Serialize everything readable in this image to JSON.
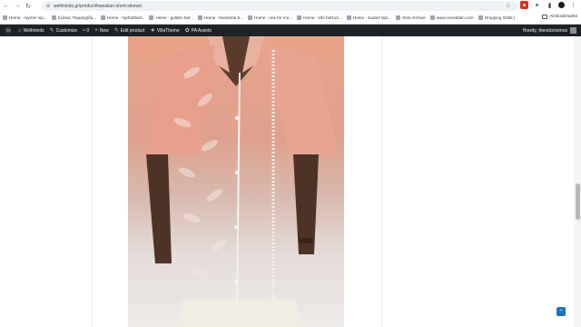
{
  "browser": {
    "url": "wellminds.gr/product/hawaiian-short-sleeve/",
    "bookmarks": [
      "Home - reymer wp...",
      "Σύλλας Παρασχίδη...",
      "Home - topfootball...",
      "Home - golden bet...",
      "Home - benzema b...",
      "Home - one for mo...",
      "Home - info bet1x2...",
      "Home - suarez tips...",
      "Sms Archive",
      "www.cenoddan.com",
      "Dropping Odds |"
    ],
    "all_bookmarks": "All Bookmarks"
  },
  "adminbar": {
    "site_name": "Wellminds",
    "customize": "Customize",
    "comments_count": "0",
    "new": "New",
    "edit_product": "Edit product",
    "villatheme": "VillaTheme",
    "pa_assets": "PA Assets",
    "howdy": "Howdy, theodorosmos"
  },
  "product": {
    "image_alt": "Hawaiian short sleeve shirt",
    "colors": {
      "shirt_top": "#e9a38a",
      "shirt_bottom": "#eeeae8",
      "admin_bar": "#1d2327",
      "accent": "#1e73be"
    }
  }
}
